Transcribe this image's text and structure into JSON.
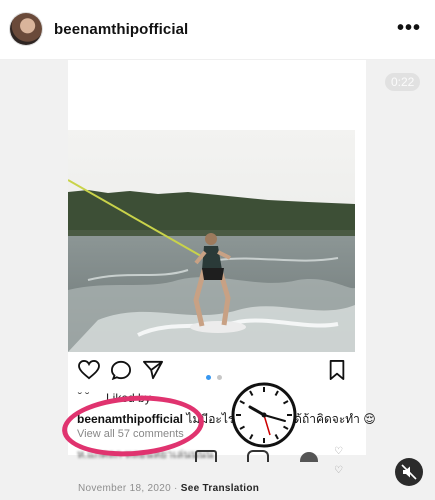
{
  "header": {
    "username": "beenamthipofficial",
    "more_icon": "more-horizontal-icon",
    "more_glyph": "•••"
  },
  "video": {
    "timer": "0:22",
    "muted": true
  },
  "inner_post": {
    "liked_by": "Liked by",
    "caption_user": "beenamthipofficial",
    "caption_text": "ไม่มีอะไรที่เราทำไม่ได้ถ้าคิดจะทำ 😌",
    "view_comments": "View all 57 comments",
    "blurred_comment": "ห.แกคลก หลอนหยาเล่นนนน",
    "date": "November 18, 2020",
    "see_translation": "See Translation",
    "separator": "·",
    "carousel_active": 0,
    "carousel_count": 2
  },
  "colors": {
    "annotation": "#e0336f",
    "carousel_active": "#3897f0"
  }
}
